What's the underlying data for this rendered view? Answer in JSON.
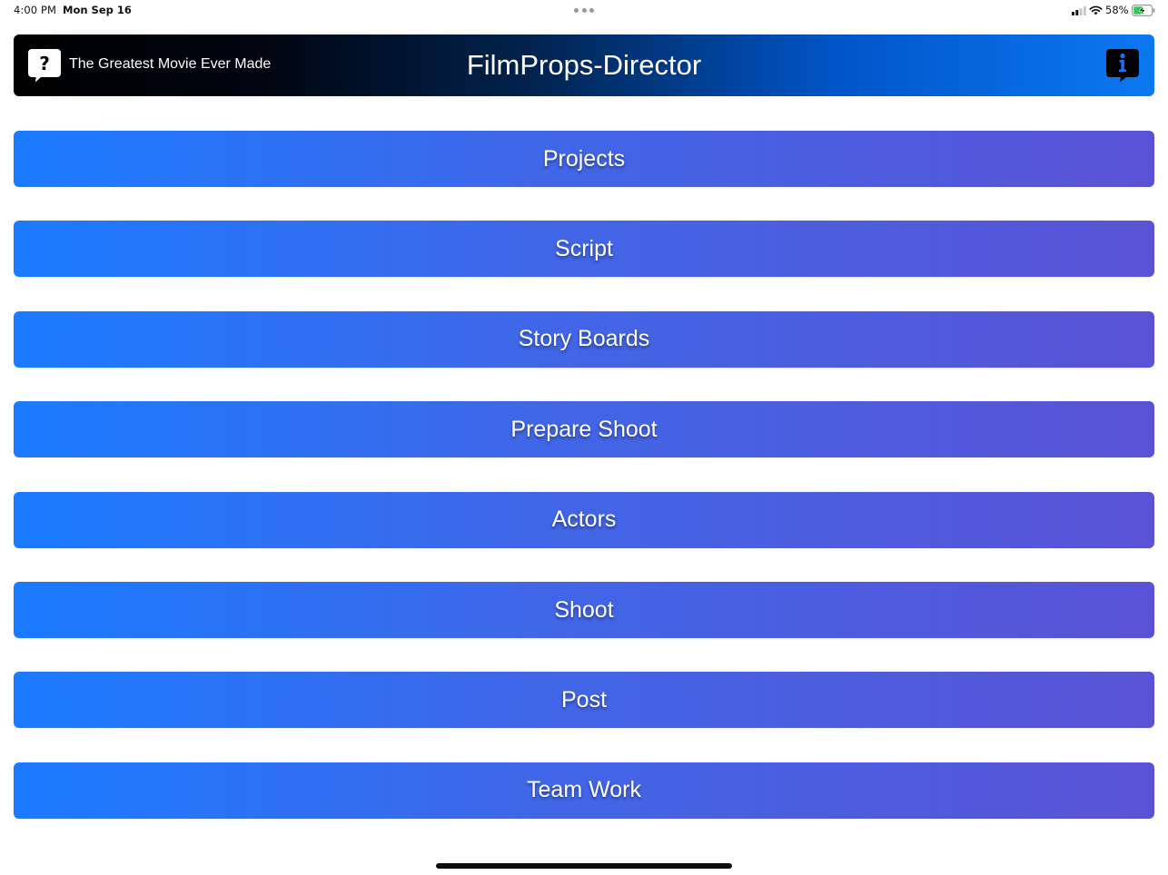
{
  "status_bar": {
    "time": "4:00 PM",
    "date": "Mon Sep 16",
    "battery_percent": "58%",
    "battery_level": 0.58,
    "charging": true
  },
  "header": {
    "help_icon": "question-bubble-icon",
    "subtitle": "The Greatest Movie Ever Made",
    "title": "FilmProps-Director",
    "info_icon": "info-bubble-icon"
  },
  "menu": {
    "items": [
      {
        "label": "Projects"
      },
      {
        "label": "Script"
      },
      {
        "label": "Story Boards"
      },
      {
        "label": "Prepare Shoot"
      },
      {
        "label": "Actors"
      },
      {
        "label": "Shoot"
      },
      {
        "label": "Post"
      },
      {
        "label": "Team Work"
      }
    ]
  },
  "colors": {
    "button_gradient_start": "#1a7bff",
    "button_gradient_end": "#5a52d6",
    "header_gradient_start": "#000000",
    "header_gradient_end": "#0a78f2",
    "battery_green": "#34c759"
  }
}
